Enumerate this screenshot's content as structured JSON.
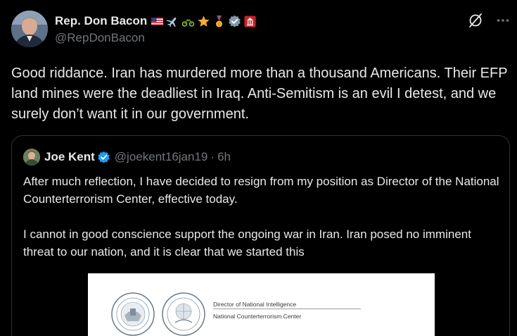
{
  "author": {
    "display_name": "Rep. Don Bacon",
    "handle": "@RepDonBacon",
    "badge_icons": [
      "us-flag-icon",
      "airplane-icon",
      "motorcycle-icon",
      "star-icon",
      "medal-icon",
      "verified-gray-icon",
      "house-seal-icon"
    ]
  },
  "actions": {
    "grok_icon": "grok-icon",
    "more_icon": "more-icon"
  },
  "post": {
    "text": "Good riddance. Iran has murdered more than a thousand Americans. Their EFP land mines were the deadliest in Iraq. Anti-Semitism is an evil I detest, and we surely don’t want it in our government."
  },
  "quoted_post": {
    "display_name": "Joe Kent",
    "handle": "@joekent16jan19",
    "separator": "·",
    "time": "6h",
    "paragraphs": [
      "After much reflection, I have decided to resign from my position as Director of the National Counterterrorism Center, effective today.",
      "I cannot in good conscience support the ongoing war in Iran. Iran posed no imminent threat to our nation, and it is clear that we started this"
    ],
    "image": {
      "line1": "Director of National Intelligence",
      "line2": "National Counterterrorism Center"
    }
  },
  "colors": {
    "background": "#000000",
    "text": "#e7e9ea",
    "secondary": "#71767b",
    "border": "#2f3336",
    "verified_blue": "#1d9bf0"
  }
}
